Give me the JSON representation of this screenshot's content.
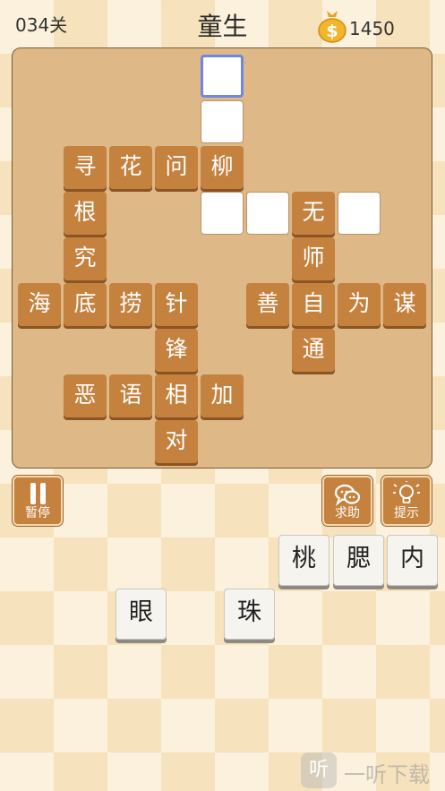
{
  "header": {
    "level": "034关",
    "title": "童生",
    "coins": "1450",
    "coin_bag_icon": "money-bag-icon"
  },
  "board": {
    "cells": [
      {
        "id": "c00",
        "char": "",
        "state": "active"
      },
      {
        "id": "c01",
        "char": "",
        "state": "blank"
      },
      {
        "id": "c02",
        "char": "寻",
        "state": "filled"
      },
      {
        "id": "c03",
        "char": "花",
        "state": "filled"
      },
      {
        "id": "c04",
        "char": "问",
        "state": "filled"
      },
      {
        "id": "c05",
        "char": "柳",
        "state": "filled"
      },
      {
        "id": "c06",
        "char": "根",
        "state": "filled"
      },
      {
        "id": "c07",
        "char": "",
        "state": "blank"
      },
      {
        "id": "c08",
        "char": "",
        "state": "blank"
      },
      {
        "id": "c09",
        "char": "无",
        "state": "filled"
      },
      {
        "id": "c10",
        "char": "",
        "state": "blank"
      },
      {
        "id": "c11",
        "char": "究",
        "state": "filled"
      },
      {
        "id": "c12",
        "char": "师",
        "state": "filled"
      },
      {
        "id": "c13",
        "char": "海",
        "state": "filled"
      },
      {
        "id": "c14",
        "char": "底",
        "state": "filled"
      },
      {
        "id": "c15",
        "char": "捞",
        "state": "filled"
      },
      {
        "id": "c16",
        "char": "针",
        "state": "filled"
      },
      {
        "id": "c17",
        "char": "善",
        "state": "filled"
      },
      {
        "id": "c18",
        "char": "自",
        "state": "filled"
      },
      {
        "id": "c19",
        "char": "为",
        "state": "filled"
      },
      {
        "id": "c20",
        "char": "谋",
        "state": "filled"
      },
      {
        "id": "c21",
        "char": "锋",
        "state": "filled"
      },
      {
        "id": "c22",
        "char": "通",
        "state": "filled"
      },
      {
        "id": "c23",
        "char": "恶",
        "state": "filled"
      },
      {
        "id": "c24",
        "char": "语",
        "state": "filled"
      },
      {
        "id": "c25",
        "char": "相",
        "state": "filled"
      },
      {
        "id": "c26",
        "char": "加",
        "state": "filled"
      },
      {
        "id": "c27",
        "char": "对",
        "state": "filled"
      }
    ]
  },
  "controls": {
    "pause_label": "暂停",
    "help_label": "求助",
    "hint_label": "提示",
    "colors": {
      "tile_brown": "#c5813e",
      "active_border": "#6f86e6"
    }
  },
  "choices": [
    "桃",
    "腮",
    "内",
    "眼",
    "珠"
  ],
  "watermark": {
    "logo": "听",
    "text": "一听下载"
  }
}
